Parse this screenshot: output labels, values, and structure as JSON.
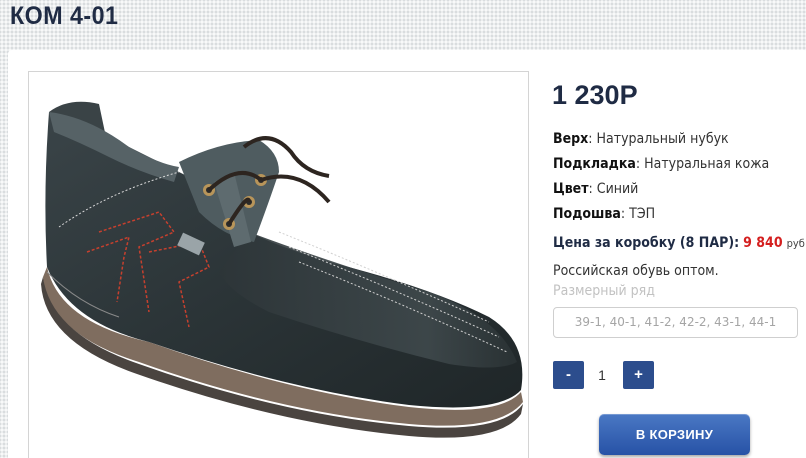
{
  "product": {
    "title": "КОМ 4-01",
    "price": "1 230Р",
    "image_alt": "dark-nubuck-lace-up-shoe"
  },
  "specs": [
    {
      "label": "Верх",
      "value": ": Натуральный нубук"
    },
    {
      "label": "Подкладка",
      "value": ": Натуральная кожа"
    },
    {
      "label": "Цвет",
      "value": ": Синий"
    },
    {
      "label": "Подошва",
      "value": ": ТЭП"
    }
  ],
  "box_price": {
    "label": "Цена за коробку (8 ПАР):",
    "value": "9 840",
    "unit": "руб"
  },
  "note": "Российская обувь оптом.",
  "size": {
    "label": "Размерный ряд",
    "selected": "39-1, 40-1, 41-2, 42-2, 43-1, 44-1"
  },
  "quantity": {
    "minus": "-",
    "value": "1",
    "plus": "+"
  },
  "cart_button": "В КОРЗИНУ",
  "colors": {
    "title": "#1f2b44",
    "accent_button": "#2c4d8d",
    "price_red": "#d41f1f"
  }
}
